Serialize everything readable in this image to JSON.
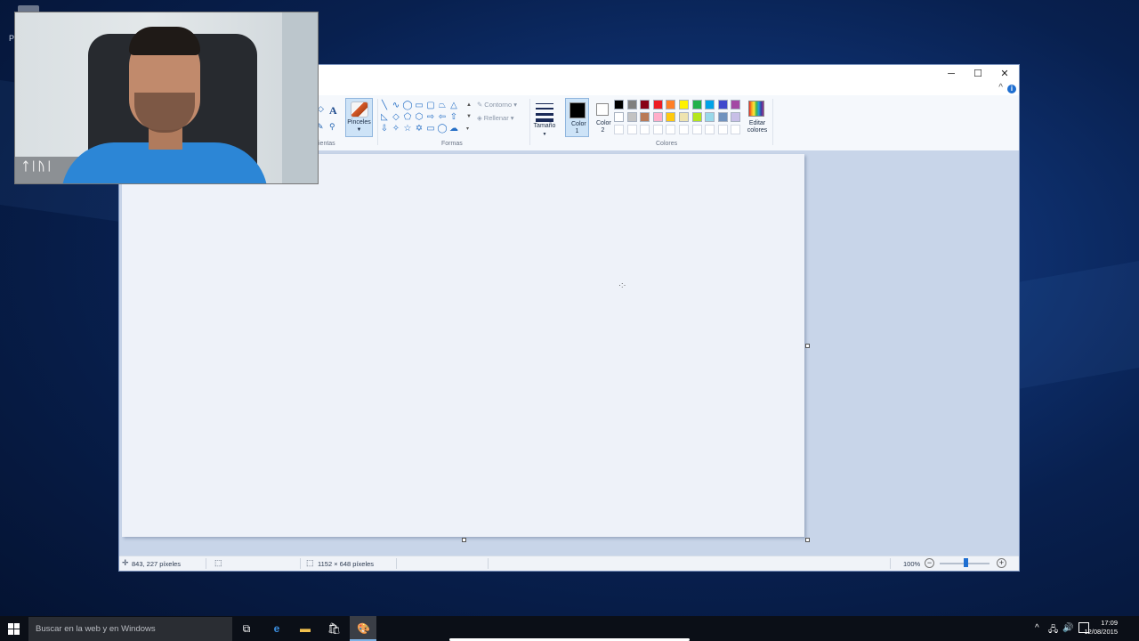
{
  "desktop": {
    "icon_label_fragment": "P"
  },
  "paint": {
    "window_controls": {
      "minimize": "─",
      "maximize": "☐",
      "close": "✕"
    },
    "help": {
      "collapse_glyph": "^",
      "info_glyph": "i"
    },
    "ribbon": {
      "tools_group_label_fragment": "ientas",
      "text_tool_glyph": "A",
      "brushes_label": "Pinceles",
      "shapes_group_label": "Formas",
      "outline_label": "Contorno",
      "fill_label": "Rellenar",
      "size_label": "Tamaño",
      "color1_label": "Color 1",
      "color2_label": "Color 2",
      "colors_group_label": "Colores",
      "edit_colors_label": "Editar colores",
      "color1_value": "#000000",
      "color2_value": "#ffffff",
      "palette_row1": [
        "#000000",
        "#7f7f7f",
        "#880015",
        "#ed1c24",
        "#ff7f27",
        "#fff200",
        "#22b14c",
        "#00a2e8",
        "#3f48cc",
        "#a349a4"
      ],
      "palette_row2": [
        "#ffffff",
        "#c3c3c3",
        "#b97a57",
        "#ffaec9",
        "#ffc90e",
        "#efe4b0",
        "#b5e61d",
        "#99d9ea",
        "#7092be",
        "#c8bfe7"
      ],
      "palette_row3": [
        "#ffffff",
        "#ffffff",
        "#ffffff",
        "#ffffff",
        "#ffffff",
        "#ffffff",
        "#ffffff",
        "#ffffff",
        "#ffffff",
        "#ffffff"
      ]
    },
    "status": {
      "cursor_position": "843, 227 píxeles",
      "canvas_size": "1152 × 648 píxeles",
      "zoom": "100%",
      "zoom_level_percent": 100
    }
  },
  "taskbar": {
    "search_placeholder": "Buscar en la web y en Windows",
    "time": "17:09",
    "date": "12/08/2015"
  }
}
